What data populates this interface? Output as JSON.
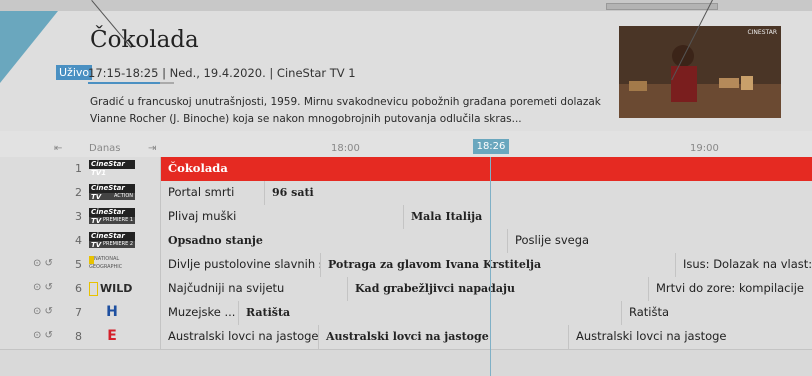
{
  "program": {
    "title": "Čokolada",
    "live_label": "Uživo",
    "time_info": "17:15-18:25 | Ned., 19.4.2020. | CineStar TV 1",
    "description": "Gradić u francuskoj unutrašnjosti, 1959. Mirnu svakodnevicu pobožnih građana poremeti dolazak Vianne Rocher (J. Binoche) koja se nakon mnogobrojnih putovanja odlučila skras...",
    "thumbnail_logo": "CINESTAR"
  },
  "timeline": {
    "day_label": "Danas",
    "times": [
      "18:00",
      "18:26",
      "19:00"
    ],
    "now_label": "18:26"
  },
  "channels": [
    {
      "num": "1",
      "logo": "CineStar TV1",
      "logo_sub": "",
      "programs": [
        {
          "title": "Čokolada",
          "bold": true
        }
      ]
    },
    {
      "num": "2",
      "logo": "CineStar TV",
      "logo_sub": "ACTION",
      "programs": [
        {
          "title": "Portal smrti",
          "bold": false
        },
        {
          "title": "96 sati",
          "bold": true
        }
      ]
    },
    {
      "num": "3",
      "logo": "CineStar TV",
      "logo_sub": "PREMIERE 1",
      "programs": [
        {
          "title": "Plivaj muški",
          "bold": false
        },
        {
          "title": "Mala Italija",
          "bold": true
        }
      ]
    },
    {
      "num": "4",
      "logo": "CineStar TV",
      "logo_sub": "PREMIERE 2",
      "programs": [
        {
          "title": "Opsadno stanje",
          "bold": true
        },
        {
          "title": "Poslije svega",
          "bold": false
        }
      ]
    },
    {
      "num": "5",
      "logo": "NATIONAL GEOGRAPHIC",
      "logo_sub": "",
      "programs": [
        {
          "title": "Divlje pustolovine slavnih s... ⊙",
          "bold": false
        },
        {
          "title": "Potraga za glavom Ivana Krstitelja",
          "bold": true
        },
        {
          "title": "Isus: Dolazak na vlast: I",
          "bold": false
        }
      ]
    },
    {
      "num": "6",
      "logo": "WILD",
      "logo_sub": "",
      "programs": [
        {
          "title": "Najčudniji na svijetu",
          "bold": false
        },
        {
          "title": "Kad grabežljivci napadaju",
          "bold": true
        },
        {
          "title": "Mrtvi do zore: kompilacije",
          "bold": false
        }
      ]
    },
    {
      "num": "7",
      "logo": "H",
      "logo_sub": "",
      "programs": [
        {
          "title": "Muzejske ...",
          "bold": false
        },
        {
          "title": "Ratišta",
          "bold": true
        },
        {
          "title": "Ratišta",
          "bold": false
        }
      ]
    },
    {
      "num": "8",
      "logo": "E",
      "logo_sub": "",
      "programs": [
        {
          "title": "Australski lovci na jastoge",
          "bold": false
        },
        {
          "title": "Australski lovci na jastoge",
          "bold": true
        },
        {
          "title": "Australski lovci na jastoge",
          "bold": false
        }
      ]
    }
  ],
  "row_icons": "⊙ ↺",
  "colors": {
    "accent": "#4a90c2",
    "live_program": "#e52a22",
    "now_marker": "#6aa7be"
  }
}
